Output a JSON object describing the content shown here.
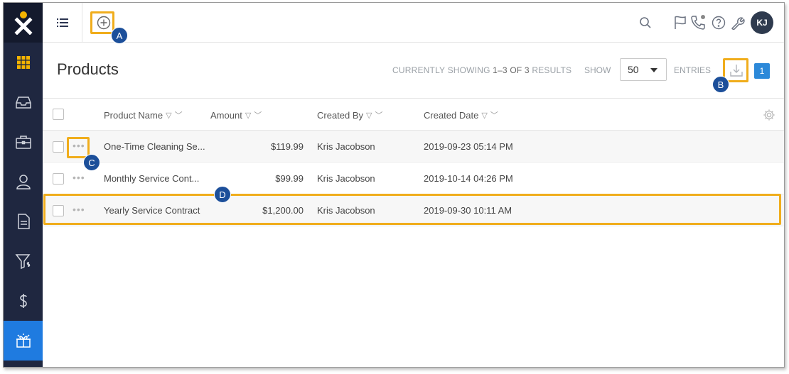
{
  "sidebar": {
    "items": [
      {
        "name": "apps",
        "icon": "grid-icon"
      },
      {
        "name": "inbox",
        "icon": "inbox-icon"
      },
      {
        "name": "briefcase",
        "icon": "briefcase-icon"
      },
      {
        "name": "contacts",
        "icon": "person-icon"
      },
      {
        "name": "documents",
        "icon": "document-icon"
      },
      {
        "name": "sales-funnel",
        "icon": "funnel-dollar-icon"
      },
      {
        "name": "payments",
        "icon": "dollar-icon"
      },
      {
        "name": "products",
        "icon": "gift-box-icon",
        "active": true
      }
    ]
  },
  "topbar": {
    "avatar_initials": "KJ"
  },
  "header": {
    "title": "Products",
    "showing_prefix": "CURRENTLY SHOWING ",
    "showing_range": "1–3 OF 3",
    "showing_suffix": " RESULTS",
    "show_label": "SHOW",
    "show_value": "50",
    "entries_label": "ENTRIES",
    "page_number": "1"
  },
  "table": {
    "columns": [
      "Product Name",
      "Amount",
      "Created By",
      "Created Date"
    ],
    "rows": [
      {
        "name": "One-Time Cleaning Se...",
        "amount": "$119.99",
        "created_by": "Kris Jacobson",
        "created_date": "2019-09-23 05:14 PM"
      },
      {
        "name": "Monthly Service Cont...",
        "amount": "$99.99",
        "created_by": "Kris Jacobson",
        "created_date": "2019-10-14 04:26 PM"
      },
      {
        "name": "Yearly Service Contract",
        "amount": "$1,200.00",
        "created_by": "Kris Jacobson",
        "created_date": "2019-09-30 10:11 AM"
      }
    ]
  },
  "annotations": {
    "a": "A",
    "b": "B",
    "c": "C",
    "d": "D",
    "highlight_color": "#f0ad1c",
    "marker_color": "#1c4f9a"
  },
  "colors": {
    "sidebar_bg": "#1f2740",
    "active_item": "#1f7be0",
    "logo_accent": "#f5b400"
  }
}
